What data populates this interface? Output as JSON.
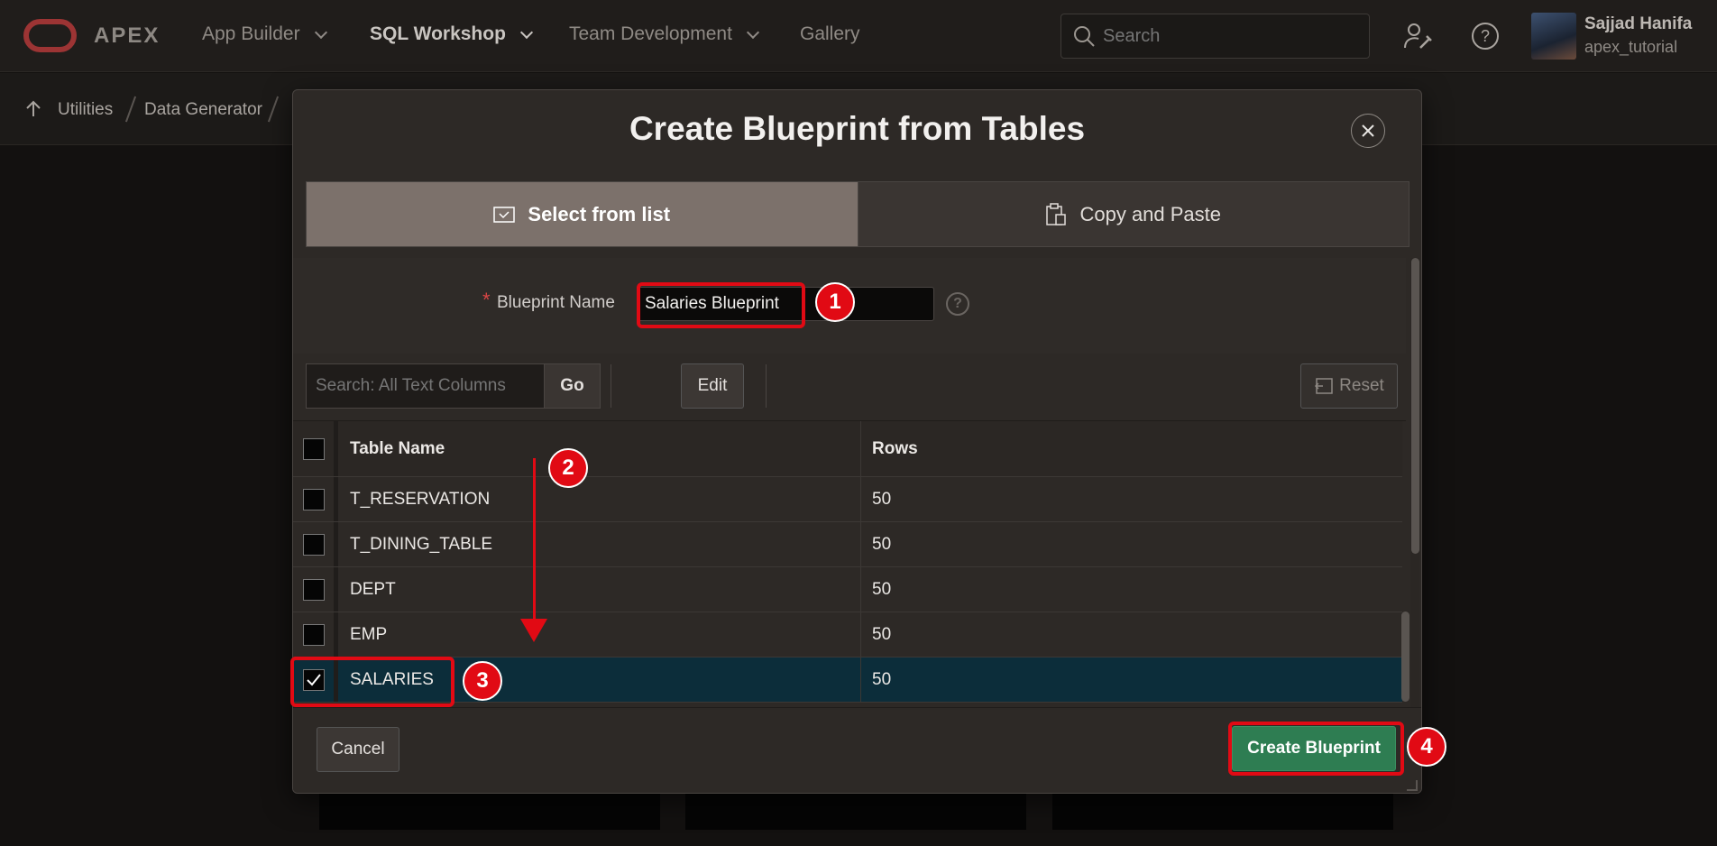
{
  "nav": {
    "brand": "APEX",
    "items": [
      {
        "label": "App Builder"
      },
      {
        "label": "SQL Workshop"
      },
      {
        "label": "Team Development"
      },
      {
        "label": "Gallery"
      }
    ],
    "search_placeholder": "Search",
    "user": {
      "name": "Sajjad Hanifa",
      "workspace": "apex_tutorial"
    }
  },
  "breadcrumb": [
    "Utilities",
    "Data Generator"
  ],
  "dialog": {
    "title": "Create Blueprint from Tables",
    "tabs": [
      {
        "label": "Select from list",
        "active": true
      },
      {
        "label": "Copy and Paste",
        "active": false
      }
    ],
    "blueprint_name_label": "Blueprint Name",
    "blueprint_name_value": "Salaries Blueprint",
    "toolbar": {
      "search_placeholder": "Search: All Text Columns",
      "go_label": "Go",
      "edit_label": "Edit",
      "reset_label": "Reset"
    },
    "table": {
      "columns": [
        "Table Name",
        "Rows"
      ],
      "rows": [
        {
          "name": "T_RESERVATION",
          "rows": "50",
          "checked": false
        },
        {
          "name": "T_DINING_TABLE",
          "rows": "50",
          "checked": false
        },
        {
          "name": "DEPT",
          "rows": "50",
          "checked": false
        },
        {
          "name": "EMP",
          "rows": "50",
          "checked": false
        },
        {
          "name": "SALARIES",
          "rows": "50",
          "checked": true
        }
      ]
    },
    "cancel_label": "Cancel",
    "create_label": "Create Blueprint"
  },
  "annotations": [
    "1",
    "2",
    "3",
    "4"
  ],
  "colors": {
    "accent_red": "#e10a14",
    "create_green": "#2e7d52",
    "selected_row": "#0c2d3a"
  }
}
